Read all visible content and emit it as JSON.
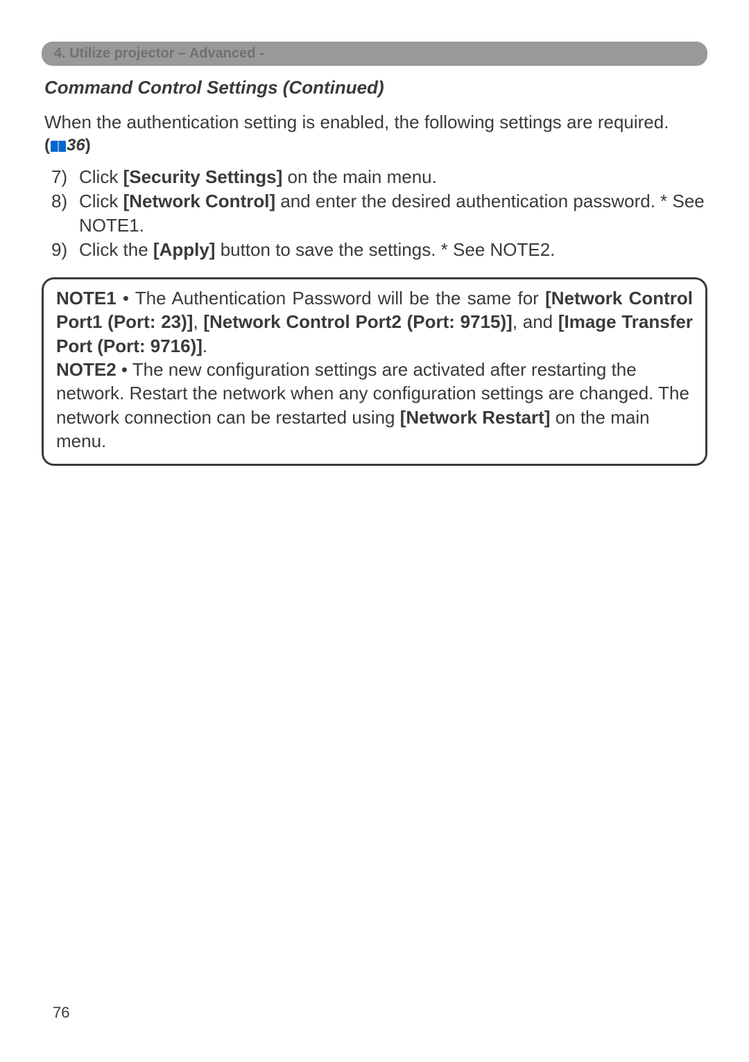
{
  "chapter_bar": "4. Utilize projector – Advanced -",
  "section_heading": "Command Control Settings (Continued)",
  "intro_text": "When the authentication setting is enabled, the following settings are required.",
  "page_ref": "36",
  "steps": [
    {
      "num": "7)",
      "pre": "Click ",
      "bold1": "[Security Settings]",
      "post": " on the main menu."
    },
    {
      "num": "8)",
      "pre": "Click ",
      "bold1": "[Network Control]",
      "post": " and enter the desired authentication password. * See NOTE1."
    },
    {
      "num": "9)",
      "pre": "Click the ",
      "bold1": "[Apply]",
      "post": " button to save the settings. * See NOTE2."
    }
  ],
  "notes": {
    "note1_label": "NOTE1",
    "note1_text_a": "  • The Authentication Password will be the same for ",
    "note1_bold_a": "[Network Control Port1 (Port: 23)]",
    "note1_text_b": ", ",
    "note1_bold_b": "[Network Control Port2 (Port: 9715)]",
    "note1_text_c": ", and ",
    "note1_bold_c": "[Image Transfer Port (Port: 9716)]",
    "note1_text_d": ".",
    "note2_label": "NOTE2",
    "note2_text_a": "  • The new configuration settings are activated after restarting the network. Restart the network when any configuration settings are changed. The network connection can be restarted using ",
    "note2_bold_a": "[Network Restart]",
    "note2_text_b": " on the main menu."
  },
  "page_number": "76"
}
